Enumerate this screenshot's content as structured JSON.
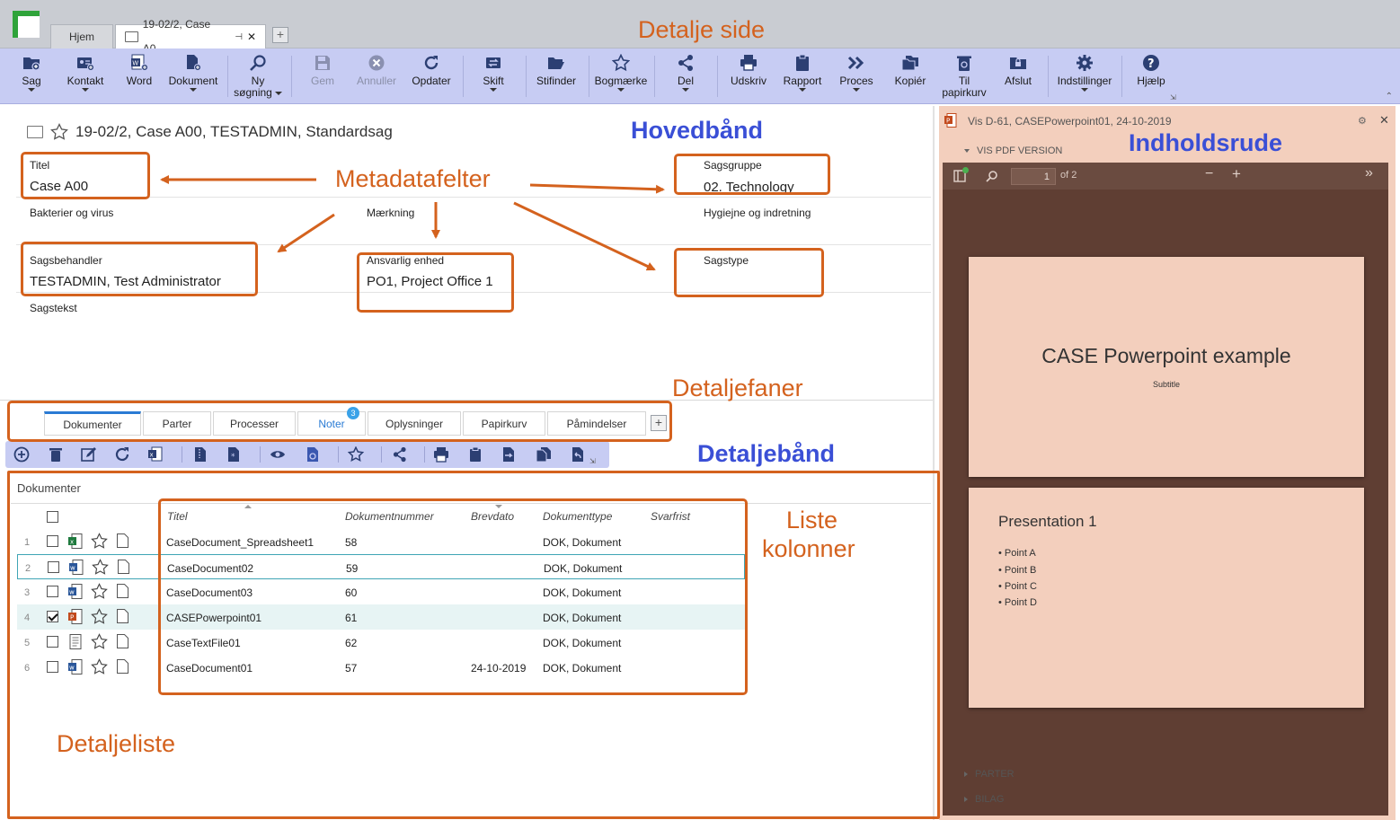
{
  "tabs": {
    "home": "Hjem",
    "case": "19-02/2, Case A0...",
    "add": "+"
  },
  "ribbon": {
    "buttons": [
      {
        "label": "Sag",
        "icon": "folder-add-icon"
      },
      {
        "label": "Kontakt",
        "icon": "contact-card-icon"
      },
      {
        "label": "Word",
        "icon": "word-document-icon"
      },
      {
        "label": "Dokument",
        "icon": "document-add-icon"
      },
      {
        "label": "Ny",
        "label2": "søgning",
        "icon": "search-icon"
      },
      {
        "label": "Gem",
        "icon": "save-icon"
      },
      {
        "label": "Annuller",
        "icon": "cancel-icon"
      },
      {
        "label": "Opdater",
        "icon": "refresh-icon"
      },
      {
        "label": "Skift",
        "icon": "switch-icon"
      },
      {
        "label": "Stifinder",
        "icon": "folder-open-icon"
      },
      {
        "label": "Bogmærke",
        "icon": "star-icon"
      },
      {
        "label": "Del",
        "icon": "share-icon"
      },
      {
        "label": "Udskriv",
        "icon": "print-icon"
      },
      {
        "label": "Rapport",
        "icon": "clipboard-icon"
      },
      {
        "label": "Proces",
        "icon": "process-icon"
      },
      {
        "label": "Kopiér",
        "icon": "copy-icon"
      },
      {
        "label": "Til",
        "label2": "papirkurv",
        "icon": "recycle-bin-icon"
      },
      {
        "label": "Afslut",
        "icon": "lock-icon"
      },
      {
        "label": "Indstillinger",
        "icon": "gear-icon"
      },
      {
        "label": "Hjælp",
        "icon": "help-icon"
      }
    ]
  },
  "case": {
    "header": "19-02/2, Case A00, TESTADMIN, Standardsag"
  },
  "fields": {
    "titel_label": "Titel",
    "titel_value": "Case A00",
    "sagsgruppe_label": "Sagsgruppe",
    "sagsgruppe_value": "02. Technology",
    "bakterier": "Bakterier og virus",
    "maerkning": "Mærkning",
    "hygiejne": "Hygiejne og indretning",
    "sagsbehandler_label": "Sagsbehandler",
    "sagsbehandler_value": "TESTADMIN, Test Administrator",
    "ansvarlig_label": "Ansvarlig enhed",
    "ansvarlig_value": "PO1, Project Office 1",
    "sagstype_label": "Sagstype",
    "sagstekst": "Sagstekst"
  },
  "annotations": {
    "detalje_side": "Detalje side",
    "hovedbaand": "Hovedbånd",
    "indholdsrude": "Indholdsrude",
    "metadatafelter": "Metadatafelter",
    "detaljefaner": "Detaljefaner",
    "detaljebaand": "Detaljebånd",
    "liste": "Liste",
    "kolonner": "kolonner",
    "detaljeliste": "Detaljeliste"
  },
  "detail_tabs": {
    "items": [
      "Dokumenter",
      "Parter",
      "Processer",
      "Noter",
      "Oplysninger",
      "Papirkurv",
      "Påmindelser"
    ],
    "noter_badge": "3",
    "add": "+"
  },
  "list": {
    "title": "Dokumenter",
    "columns": [
      "Titel",
      "Dokumentnummer",
      "Brevdato",
      "Dokumenttype",
      "Svarfrist"
    ],
    "rows": [
      {
        "n": "1",
        "titel": "CaseDocument_Spreadsheet1",
        "nummer": "58",
        "brevdato": "",
        "type": "DOK, Dokument",
        "svarfrist": "",
        "icon": "excel-file-icon",
        "checked": false
      },
      {
        "n": "2",
        "titel": "CaseDocument02",
        "nummer": "59",
        "brevdato": "",
        "type": "DOK, Dokument",
        "svarfrist": "",
        "icon": "word-file-icon",
        "checked": false
      },
      {
        "n": "3",
        "titel": "CaseDocument03",
        "nummer": "60",
        "brevdato": "",
        "type": "DOK, Dokument",
        "svarfrist": "",
        "icon": "word-file-icon",
        "checked": false
      },
      {
        "n": "4",
        "titel": "CASEPowerpoint01",
        "nummer": "61",
        "brevdato": "",
        "type": "DOK, Dokument",
        "svarfrist": "",
        "icon": "powerpoint-file-icon",
        "checked": true
      },
      {
        "n": "5",
        "titel": "CaseTextFile01",
        "nummer": "62",
        "brevdato": "",
        "type": "DOK, Dokument",
        "svarfrist": "",
        "icon": "text-file-icon",
        "checked": false
      },
      {
        "n": "6",
        "titel": "CaseDocument01",
        "nummer": "57",
        "brevdato": "24-10-2019",
        "type": "DOK, Dokument",
        "svarfrist": "",
        "icon": "word-file-icon",
        "checked": false
      }
    ]
  },
  "preview": {
    "title": "Vis D-61, CASEPowerpoint01, 24-10-2019",
    "vis_pdf": "VIS PDF VERSION",
    "page": "1",
    "of": "of 2",
    "slide1_title": "CASE Powerpoint example",
    "slide1_subtitle": "Subtitle",
    "slide2_title": "Presentation 1",
    "bullets": [
      "• Point A",
      "• Point B",
      "• Point C",
      "• Point D"
    ],
    "parter": "PARTER",
    "bilag": "BILAG"
  },
  "colors": {
    "accent_orange": "#d4621e",
    "annotation_blue": "#3a4fd6",
    "ribbon": "#c7ccf3",
    "preview_bg": "#f3cfbd",
    "viewer_bg": "#5f3e33"
  }
}
